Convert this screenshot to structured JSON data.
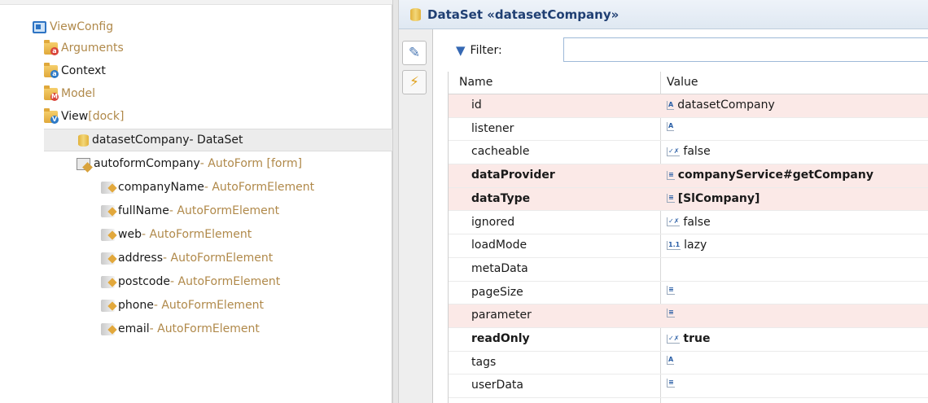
{
  "tree": {
    "root": {
      "label": "ViewConfig",
      "icon": "viewconfig-icon"
    },
    "nodes": [
      {
        "label": "Arguments",
        "icon": "folder-arguments-icon",
        "badge": "a",
        "badge_color": "#d9443a"
      },
      {
        "label": "Context",
        "icon": "folder-context-icon",
        "badge": "a",
        "badge_color": "#2d7ac7"
      },
      {
        "label": "Model",
        "icon": "folder-model-icon",
        "badge": "M",
        "badge_color": "#d9443a"
      },
      {
        "label": "View",
        "suffix": " [dock]",
        "icon": "folder-view-icon",
        "badge": "V",
        "badge_color": "#2d7ac7"
      }
    ],
    "dataset": {
      "name": "datasetCompany",
      "type": " - DataSet"
    },
    "autoform": {
      "name": "autoformCompany",
      "type": " - AutoForm [form]"
    },
    "elements": [
      {
        "name": "companyName",
        "type": " - AutoFormElement"
      },
      {
        "name": "fullName",
        "type": " - AutoFormElement"
      },
      {
        "name": "web",
        "type": " - AutoFormElement"
      },
      {
        "name": "address",
        "type": " - AutoFormElement"
      },
      {
        "name": "postcode",
        "type": " - AutoFormElement"
      },
      {
        "name": "phone",
        "type": " - AutoFormElement"
      },
      {
        "name": "email",
        "type": " - AutoFormElement"
      }
    ]
  },
  "panel": {
    "title": "DataSet «datasetCompany»",
    "filter_label": "Filter:",
    "filter_value": "",
    "columns": {
      "name": "Name",
      "value": "Value"
    },
    "properties": [
      {
        "name": "id",
        "value": "datasetCompany",
        "icon": "A"
      },
      {
        "name": "listener",
        "value": "",
        "icon": "A"
      },
      {
        "name": "cacheable",
        "value": "false",
        "icon": "✓✗"
      },
      {
        "name": "dataProvider",
        "value": "companyService#getCompany",
        "icon": "≡",
        "bold": true
      },
      {
        "name": "dataType",
        "value": "[SlCompany]",
        "icon": "≡",
        "bold": true
      },
      {
        "name": "ignored",
        "value": "false",
        "icon": "✓✗"
      },
      {
        "name": "loadMode",
        "value": "lazy",
        "icon": "1.1"
      },
      {
        "name": "metaData",
        "value": "",
        "icon": ""
      },
      {
        "name": "pageSize",
        "value": "",
        "icon": "≡"
      },
      {
        "name": "parameter",
        "value": "",
        "icon": "≡"
      },
      {
        "name": "readOnly",
        "value": "true",
        "icon": "✓✗",
        "bold": true
      },
      {
        "name": "tags",
        "value": "",
        "icon": "A"
      },
      {
        "name": "userData",
        "value": "",
        "icon": "≡"
      }
    ]
  },
  "colors": {
    "accent": "#1f3f73",
    "type_text": "#b0894a",
    "alt_row": "#fbe9e7"
  }
}
